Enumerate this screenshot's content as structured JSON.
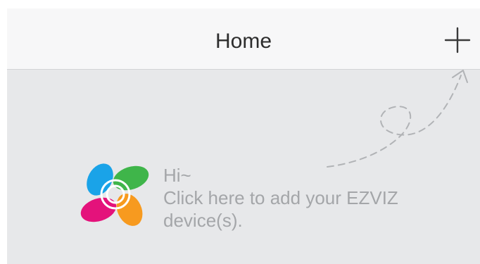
{
  "header": {
    "title": "Home",
    "add_icon": "plus-icon"
  },
  "empty_state": {
    "logo": "ezviz-logo",
    "greeting": "Hi~",
    "message_line1": "Click here to add your EZVIZ",
    "message_line2": "device(s)."
  },
  "colors": {
    "header_bg": "#f7f7f8",
    "content_bg": "#e7e8ea",
    "title_text": "#2d2d2d",
    "hint_text": "#a4a6a9",
    "logo_blue": "#1aa3e8",
    "logo_green": "#3fb54a",
    "logo_magenta": "#e4127b",
    "logo_orange": "#f79a1f"
  }
}
